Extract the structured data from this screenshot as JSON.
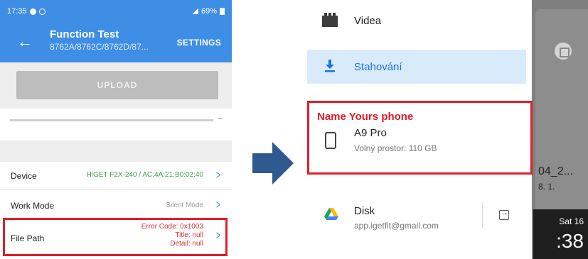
{
  "left_phone": {
    "status_bar": {
      "time": "17:35",
      "battery": "69%"
    },
    "header": {
      "title": "Function Test",
      "subtitle": "8762A/8762C/8762D/87...",
      "settings_label": "SETTINGS"
    },
    "upload_label": "UPLOAD",
    "progress_dash": "–",
    "rows": {
      "device": {
        "label": "Device",
        "value": "HiGET F2X-240 / AC:4A:21:B0:02:40"
      },
      "work_mode": {
        "label": "Work Mode",
        "value": "Silent Mode"
      },
      "file_path": {
        "label": "File Path",
        "error_code": "Error Code: 0x1003",
        "title_line": "Title: null",
        "detail_line": "Detail: null"
      }
    }
  },
  "right_phone": {
    "drawer": {
      "videa_label": "Videa",
      "stahovani_label": "Stahování",
      "highlight_title": "Name Yours phone",
      "device_name": "A9 Pro",
      "device_storage": "Volný prostor: 110 GB",
      "disk_label": "Disk",
      "disk_account": "app.igetfit@gmail.com"
    },
    "background": {
      "file_text": "04_2...",
      "file_date": "8. 1.",
      "clock_date": "Sat 16",
      "clock_time": ":38"
    }
  },
  "colors": {
    "app_blue": "#3f8ee6",
    "highlight_red": "#e11d2a",
    "device_value_green": "#3aa547",
    "selected_bg": "#d9ebfb",
    "arrow_blue": "#2f5a8f"
  },
  "icons": [
    "back-arrow-icon",
    "chevron-right-icon",
    "film-icon",
    "download-icon",
    "phone-icon",
    "google-drive-icon",
    "eject-icon",
    "fullscreen-icon"
  ]
}
